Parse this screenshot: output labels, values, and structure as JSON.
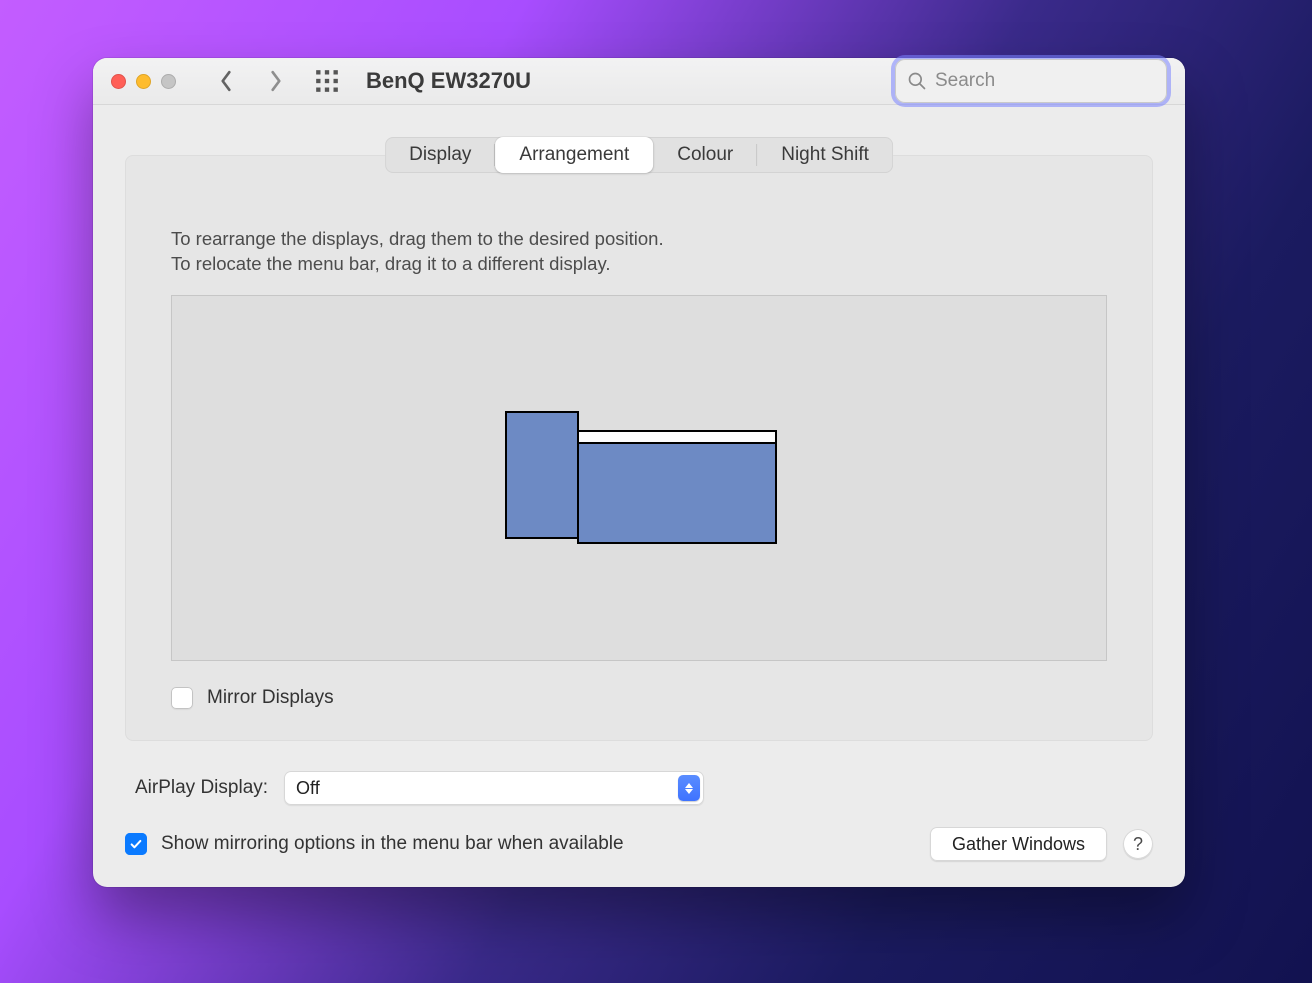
{
  "window": {
    "title": "BenQ EW3270U"
  },
  "search": {
    "placeholder": "Search",
    "value": ""
  },
  "tabs": [
    {
      "label": "Display",
      "active": false
    },
    {
      "label": "Arrangement",
      "active": true
    },
    {
      "label": "Colour",
      "active": false
    },
    {
      "label": "Night Shift",
      "active": false
    }
  ],
  "instructions": {
    "line1": "To rearrange the displays, drag them to the desired position.",
    "line2": "To relocate the menu bar, drag it to a different display."
  },
  "mirror": {
    "label": "Mirror Displays",
    "checked": false
  },
  "airplay": {
    "label": "AirPlay Display:",
    "value": "Off"
  },
  "show_mirroring": {
    "label": "Show mirroring options in the menu bar when available",
    "checked": true
  },
  "gather": {
    "label": "Gather Windows"
  },
  "help": {
    "label": "?"
  }
}
